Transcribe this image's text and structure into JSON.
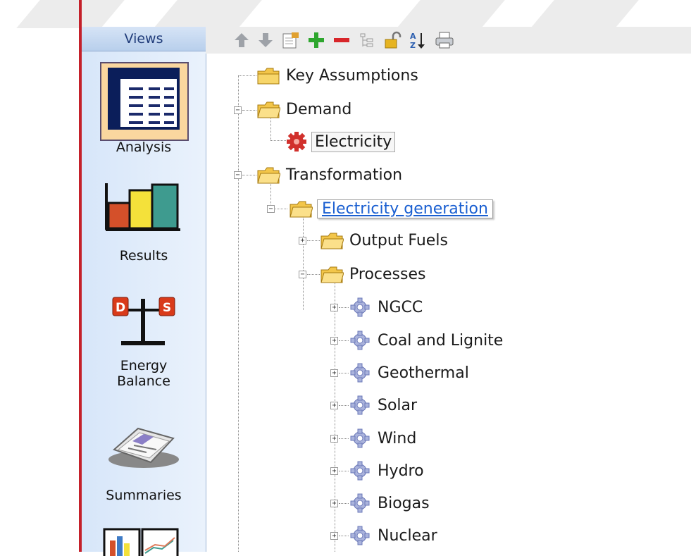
{
  "sidebar": {
    "header": "Views",
    "items": [
      {
        "label": "Analysis",
        "icon": "analysis-icon",
        "selected": true
      },
      {
        "label": "Results",
        "icon": "results-icon"
      },
      {
        "label_line1": "Energy",
        "label_line2": "Balance",
        "icon": "energy-balance-icon",
        "badge_left": "D",
        "badge_right": "S"
      },
      {
        "label": "Summaries",
        "icon": "summaries-icon"
      }
    ]
  },
  "toolbar": {
    "buttons": [
      "move-up-icon",
      "move-down-icon",
      "properties-icon",
      "add-icon",
      "delete-icon",
      "tree-icon",
      "lock-icon",
      "sort-icon",
      "print-icon"
    ],
    "sort_glyph": "A Z"
  },
  "tree": {
    "key_assumptions": "Key Assumptions",
    "demand": "Demand",
    "demand_children": [
      "Electricity"
    ],
    "transformation": "Transformation",
    "electricity_generation": "Electricity generation",
    "output_fuels": "Output Fuels",
    "processes": "Processes",
    "process_items": [
      "NGCC",
      "Coal and Lignite",
      "Geothermal",
      "Solar",
      "Wind",
      "Hydro",
      "Biogas",
      "Nuclear"
    ]
  },
  "colors": {
    "sidebar_bg": "#d7e6f9",
    "selected_view": "#fad79f",
    "link": "#1a5fd1",
    "folder": "#f3c64a",
    "gear_active": "#d1302c",
    "gear_inactive": "#8f9ccf"
  }
}
